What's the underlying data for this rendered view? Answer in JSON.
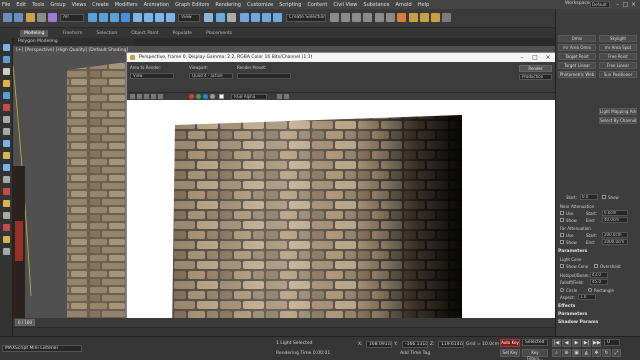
{
  "menubar": {
    "items": [
      "File",
      "Edit",
      "Tools",
      "Group",
      "Views",
      "Create",
      "Modifiers",
      "Animation",
      "Graph Editors",
      "Rendering",
      "Customize",
      "Scripting",
      "Content",
      "Civil View",
      "Substance",
      "Arnold",
      "Help"
    ],
    "workspace_label": "Workspaces",
    "workspace_value": "Default",
    "user_label": "Sign In"
  },
  "toolbar": {
    "filter_value": "All",
    "selection_set": "Create Selection Set",
    "view_value": "View"
  },
  "ribbon": {
    "tabs": [
      "Modeling",
      "Freeform",
      "Selection",
      "Object Paint",
      "Populate",
      "Placements"
    ],
    "active_index": 0,
    "sublabel": "Polygon Modeling"
  },
  "viewport": {
    "label": "[+] [Perspective] [High Quality] [Default Shading]"
  },
  "render_frame": {
    "title": "Perspective, frame 0, Display Gamma: 2.2, RGBA Color 16 Bits/Channel (1:1)",
    "area_label": "Area to Render:",
    "area_value": "View",
    "viewport_label": "Viewport:",
    "viewport_value": "Quad 4 - active",
    "preset_label": "Render Preset:",
    "preset_value": "",
    "render_button": "Render",
    "production_value": "Production",
    "channel_value": "RGB Alpha"
  },
  "command_panel": {
    "buttons": [
      "Omni",
      "Skylight",
      "mr Area Omni",
      "mr Area Spot",
      "Target Point",
      "Free Point",
      "Target Linear",
      "Free Linear",
      "Photometric Web",
      "Sun Positioner",
      "Light Mapping Add",
      "Select By Channel"
    ],
    "start_label": "Start:",
    "start_value": "0.0",
    "show_label": "Show",
    "near_atten_label": "Near Attenuation",
    "use_label": "Use",
    "start2_value": "0.0cm",
    "end_label": "End:",
    "end_value": "40.0cm",
    "far_atten_label": "Far Attenuation",
    "far_start_value": "200.0cm",
    "far_end_value": "2000.0cm",
    "params_head": "Parameters",
    "light_cone_label": "Light Cone",
    "show_cone_label": "Show Cone",
    "overshoot_label": "Overshoot",
    "hotspot_label": "Hotspot/Beam:",
    "hotspot_value": "43.0",
    "falloff_label": "Falloff/Field:",
    "falloff_value": "45.0",
    "circle_label": "Circle",
    "rectangle_label": "Rectangle",
    "aspect_label": "Aspect:",
    "aspect_value": "1.0",
    "effects_head": "Effects",
    "params2_head": "Parameters",
    "shadow_head": "Shadow Params"
  },
  "status": {
    "listener": "MAXScript Mini Listener",
    "selected": "1 Light Selected",
    "rendering_time": "Rendering Time 0:00:01",
    "x_label": "X:",
    "x_value": "168.091cm",
    "y_label": "Y:",
    "y_value": "-166.131cm",
    "z_label": "Z:",
    "z_value": "119.614cm",
    "grid": "Grid = 10.0cm",
    "add_time_tag": "Add Time Tag",
    "autokey": "Auto Key",
    "selected_dd": "Selected",
    "set_key": "Set Key",
    "key_filters": "Key Filters...",
    "frame_value": "0",
    "timeline_pos": "0 / 100"
  }
}
